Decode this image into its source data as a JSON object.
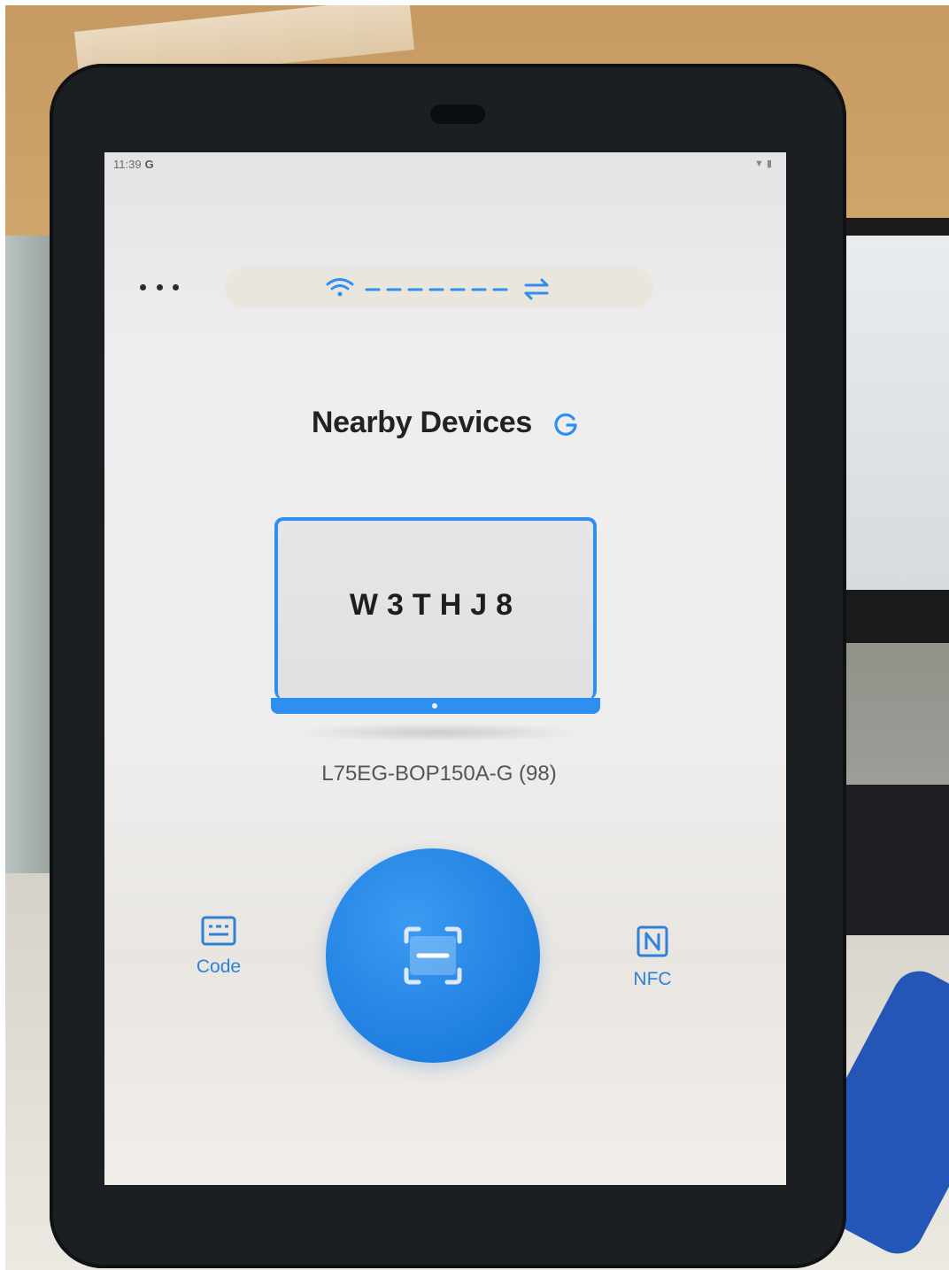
{
  "status_bar": {
    "time": "11:39",
    "google_indicator": "G",
    "icons": [
      "wifi-icon",
      "battery-icon"
    ]
  },
  "toolbar": {
    "more_icon": "more-dots-icon",
    "connection_icons": [
      "wifi-icon",
      "dashed-line",
      "transfer-arrows-icon"
    ]
  },
  "header": {
    "title": "Nearby Devices",
    "refresh_icon": "refresh-icon"
  },
  "device": {
    "code": "W3THJ8",
    "name": "L75EG-BOP150A-G (98)"
  },
  "actions": {
    "code_label": "Code",
    "nfc_label": "NFC",
    "scan_icon": "scan-icon"
  },
  "colors": {
    "accent": "#2f8ff0",
    "scan_button": "#1f7fe0",
    "text_dark": "#222222",
    "label_blue": "#2f80d8"
  }
}
